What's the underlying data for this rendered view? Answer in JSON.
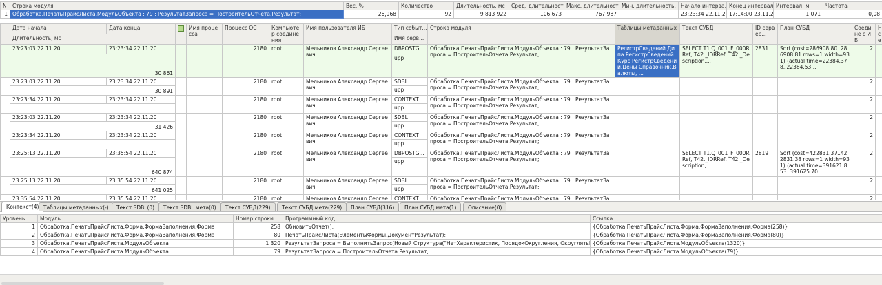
{
  "summary": {
    "headers": [
      "N",
      "Строка модуля",
      "Вес, %",
      "Количество",
      "Длительность, мс",
      "Сред. длительность, мс",
      "Макс. длительность, ...",
      "Мин. длительность, ...",
      "Начало интерва...",
      "Конец интервала",
      "Интервал, м",
      "Частота"
    ],
    "row": [
      "1",
      "Обработка.ПечатьПрайсЛиста.МодульОбъекта : 79 : РезультатЗапроса = ПостроительОтчета.Результат;",
      "26,968",
      "92",
      "9 813 922",
      "106 673",
      "767 987",
      "",
      "23:23:34 22.11.20",
      "17:14:00 23.11.20",
      "1 071",
      "0,08"
    ]
  },
  "events": {
    "headers": {
      "start": "Дата начала",
      "end": "Дата конца",
      "duration": "Длительность, мс",
      "proc_name": "Имя процесса",
      "os_proc": "Процесс ОС",
      "computer": "Компьютер соединения",
      "user": "Имя пользователя ИБ",
      "event_type": "Тип событ...",
      "db_name": "Имя серв...",
      "module_line": "Строка модуля",
      "meta_tables": "Таблицы метаданных",
      "sql": "Текст СУБД",
      "server_id": "ID сервер...",
      "plan": "План СУБД",
      "conn": "Соедине с ИБ",
      "extra": "Н се"
    },
    "rows": [
      {
        "start": "23:23:03 22.11.20",
        "end": "23:23:34 22.11.20",
        "duration": "30 861",
        "os": "2180",
        "comp": "root",
        "user": "Мельников Александр Сергеевич",
        "type": "DBPOSTG...",
        "db": "upp",
        "module": "Обработка.ПечатьПрайсЛиста.МодульОбъекта : 79 : РезультатЗапроса = ПостроительОтчета.Результат;",
        "meta": "РегистрСведений.Дипа РегистрСведений.Курс РегистрСведений.Цены Справочник.Валюты, ...",
        "sql": "SELECT T1.Q_001_F_000RRef, T42._IDRRef, T42._Description,...",
        "srv": "2831",
        "plan": "Sort (cost=286908.80..286908.81 rows=1 width=931) (actual time=22384.378..22384.53...",
        "conn": "2"
      },
      {
        "start": "23:23:03 22.11.20",
        "end": "23:23:34 22.11.20",
        "duration": "30 891",
        "os": "2180",
        "comp": "root",
        "user": "Мельников Александр Сергеевич",
        "type": "SDBL",
        "db": "upp",
        "module": "Обработка.ПечатьПрайсЛиста.МодульОбъекта : 79 : РезультатЗапроса = ПостроительОтчета.Результат;",
        "meta": "",
        "sql": "",
        "srv": "",
        "plan": "",
        "conn": "2"
      },
      {
        "start": "23:23:34 22.11.20",
        "end": "23:23:34 22.11.20",
        "duration": "",
        "os": "2180",
        "comp": "root",
        "user": "Мельников Александр Сергеевич",
        "type": "CONTEXT",
        "db": "upp",
        "module": "Обработка.ПечатьПрайсЛиста.МодульОбъекта : 79 : РезультатЗапроса = ПостроительОтчета.Результат;",
        "meta": "",
        "sql": "",
        "srv": "",
        "plan": "",
        "conn": "2"
      },
      {
        "start": "23:23:03 22.11.20",
        "end": "23:23:34 22.11.20",
        "duration": "31 426",
        "os": "2180",
        "comp": "root",
        "user": "Мельников Александр Сергеевич",
        "type": "SDBL",
        "db": "upp",
        "module": "Обработка.ПечатьПрайсЛиста.МодульОбъекта : 79 : РезультатЗапроса = ПостроительОтчета.Результат;",
        "meta": "",
        "sql": "",
        "srv": "",
        "plan": "",
        "conn": "2"
      },
      {
        "start": "23:23:34 22.11.20",
        "end": "23:23:34 22.11.20",
        "duration": "",
        "os": "2180",
        "comp": "root",
        "user": "Мельников Александр Сергеевич",
        "type": "CONTEXT",
        "db": "upp",
        "module": "Обработка.ПечатьПрайсЛиста.МодульОбъекта : 79 : РезультатЗапроса = ПостроительОтчета.Результат;",
        "meta": "",
        "sql": "",
        "srv": "",
        "plan": "",
        "conn": "2"
      },
      {
        "start": "23:25:13 22.11.20",
        "end": "23:35:54 22.11.20",
        "duration": "640 874",
        "os": "2180",
        "comp": "root",
        "user": "Мельников Александр Сергеевич",
        "type": "DBPOSTG...",
        "db": "upp",
        "module": "Обработка.ПечатьПрайсЛиста.МодульОбъекта : 79 : РезультатЗапроса = ПостроительОтчета.Результат;",
        "meta": "",
        "sql": "SELECT T1.Q_001_F_000RRef, T42._IDRRef, T42._Description,...",
        "srv": "2819",
        "plan": "Sort (cost=422831.37..422831.38 rows=1 width=931) (actual time=391621.853..391625.70",
        "conn": "2"
      },
      {
        "start": "23:25:13 22.11.20",
        "end": "23:35:54 22.11.20",
        "duration": "641 025",
        "os": "2180",
        "comp": "root",
        "user": "Мельников Александр Сергеевич",
        "type": "SDBL",
        "db": "upp",
        "module": "Обработка.ПечатьПрайсЛиста.МодульОбъекта : 79 : РезультатЗапроса = ПостроительОтчета.Результат;",
        "meta": "",
        "sql": "",
        "srv": "",
        "plan": "",
        "conn": "2"
      },
      {
        "start": "23:35:54 22.11.20",
        "end": "23:35:54 22.11.20",
        "duration": "",
        "os": "2180",
        "comp": "root",
        "user": "Мельников Александр Сергеевич",
        "type": "CONTEXT",
        "db": "upp",
        "module": "Обработка.ПечатьПрайсЛиста.МодульОбъекта : 79 : РезультатЗапроса = ПостроительОтчета.Результат;",
        "meta": "",
        "sql": "",
        "srv": "",
        "plan": "",
        "conn": "2"
      }
    ]
  },
  "tabs": [
    "Контекст(4)",
    "Таблицы метаданных(-)",
    "Текст SDBL(0)",
    "Текст SDBL мета(0)",
    "Текст СУБД(229)",
    "Текст СУБД мета(229)",
    "План СУБД(316)",
    "План СУБД мета(1)",
    "Описание(0)"
  ],
  "context": {
    "headers": [
      "Уровень",
      "Модуль",
      "Номер строки",
      "Программный код",
      "Ссылка"
    ],
    "rows": [
      [
        "1",
        "Обработка.ПечатьПрайсЛиста.Форма.ФормаЗаполнения.Форма",
        "258",
        "ОбновитьОтчет();",
        "{Обработка.ПечатьПрайсЛиста.Форма.ФормаЗаполнения.Форма(258)}"
      ],
      [
        "2",
        "Обработка.ПечатьПрайсЛиста.Форма.ФормаЗаполнения.Форма",
        "80",
        "ПечатьПрайсЛиста(ЭлементыФормы.ДокументРезультат);",
        "{Обработка.ПечатьПрайсЛиста.Форма.ФормаЗаполнения.Форма(80)}"
      ],
      [
        "3",
        "Обработка.ПечатьПрайсЛиста.МодульОбъекта",
        "1 320",
        "РезультатЗапроса = ВыполнитьЗапрос(Новый Структура(\"НетХарактеристик, ПорядокОкругления, ОкруглятьВБольшу...",
        "{Обработка.ПечатьПрайсЛиста.МодульОбъекта(1320)}"
      ],
      [
        "4",
        "Обработка.ПечатьПрайсЛиста.МодульОбъекта",
        "79",
        "РезультатЗапроса = ПостроительОтчета.Результат;",
        "{Обработка.ПечатьПрайсЛиста.МодульОбъекта(79)}"
      ]
    ]
  },
  "colors": {
    "selection": "#3a6fc4",
    "active_row": "#eefbe9",
    "header": "#efeeea"
  },
  "icons": {
    "picture_col": "picture-icon"
  }
}
